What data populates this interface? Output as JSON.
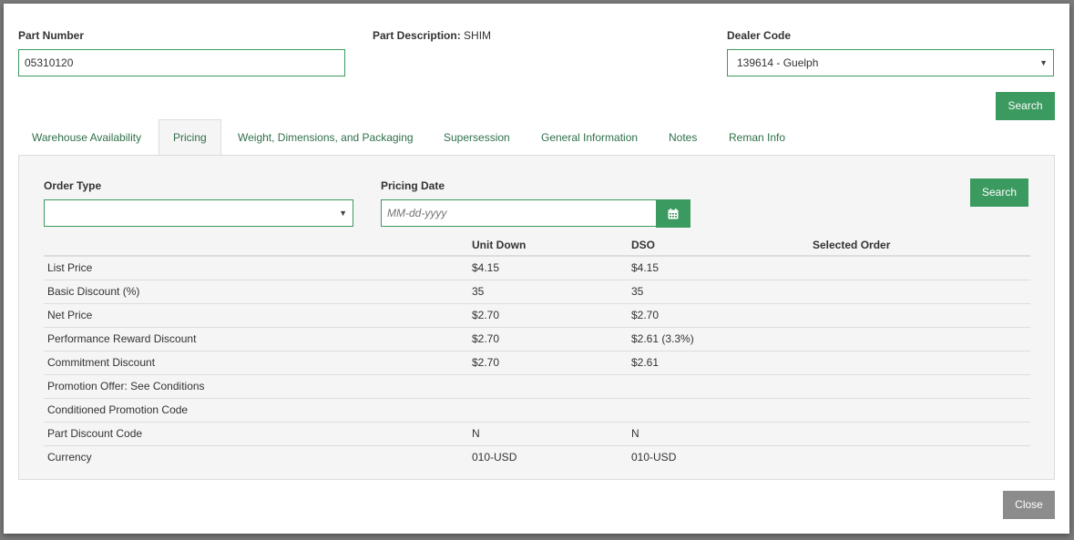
{
  "header": {
    "part_number_label": "Part Number",
    "part_number_value": "05310120",
    "part_description_label": "Part Description:",
    "part_description_value": "SHIM",
    "dealer_code_label": "Dealer Code",
    "dealer_code_value": "139614 - Guelph",
    "search_label": "Search"
  },
  "tabs": [
    {
      "label": "Warehouse Availability"
    },
    {
      "label": "Pricing"
    },
    {
      "label": "Weight, Dimensions, and Packaging"
    },
    {
      "label": "Supersession"
    },
    {
      "label": "General Information"
    },
    {
      "label": "Notes"
    },
    {
      "label": "Reman Info"
    }
  ],
  "pricing": {
    "order_type_label": "Order Type",
    "order_type_value": "",
    "pricing_date_label": "Pricing Date",
    "pricing_date_placeholder": "MM-dd-yyyy",
    "search_label": "Search",
    "columns": [
      "",
      "Unit Down",
      "DSO",
      "Selected Order"
    ],
    "rows": [
      [
        "List Price",
        "$4.15",
        "$4.15",
        ""
      ],
      [
        "Basic Discount (%)",
        "35",
        "35",
        ""
      ],
      [
        "Net Price",
        "$2.70",
        "$2.70",
        ""
      ],
      [
        "Performance Reward Discount",
        "$2.70",
        "$2.61 (3.3%)",
        ""
      ],
      [
        "Commitment Discount",
        "$2.70",
        "$2.61",
        ""
      ],
      [
        "Promotion Offer: See Conditions",
        "",
        "",
        ""
      ],
      [
        "Conditioned Promotion Code",
        "",
        "",
        ""
      ],
      [
        "Part Discount Code",
        "N",
        "N",
        ""
      ],
      [
        "Currency",
        "010-USD",
        "010-USD",
        ""
      ]
    ]
  },
  "footer": {
    "close_label": "Close"
  },
  "icons": {
    "calendar": "calendar-icon",
    "dropdown": "chevron-down-icon"
  },
  "colors": {
    "accent": "#3b9a5f",
    "close_button": "#8c8c8c"
  }
}
